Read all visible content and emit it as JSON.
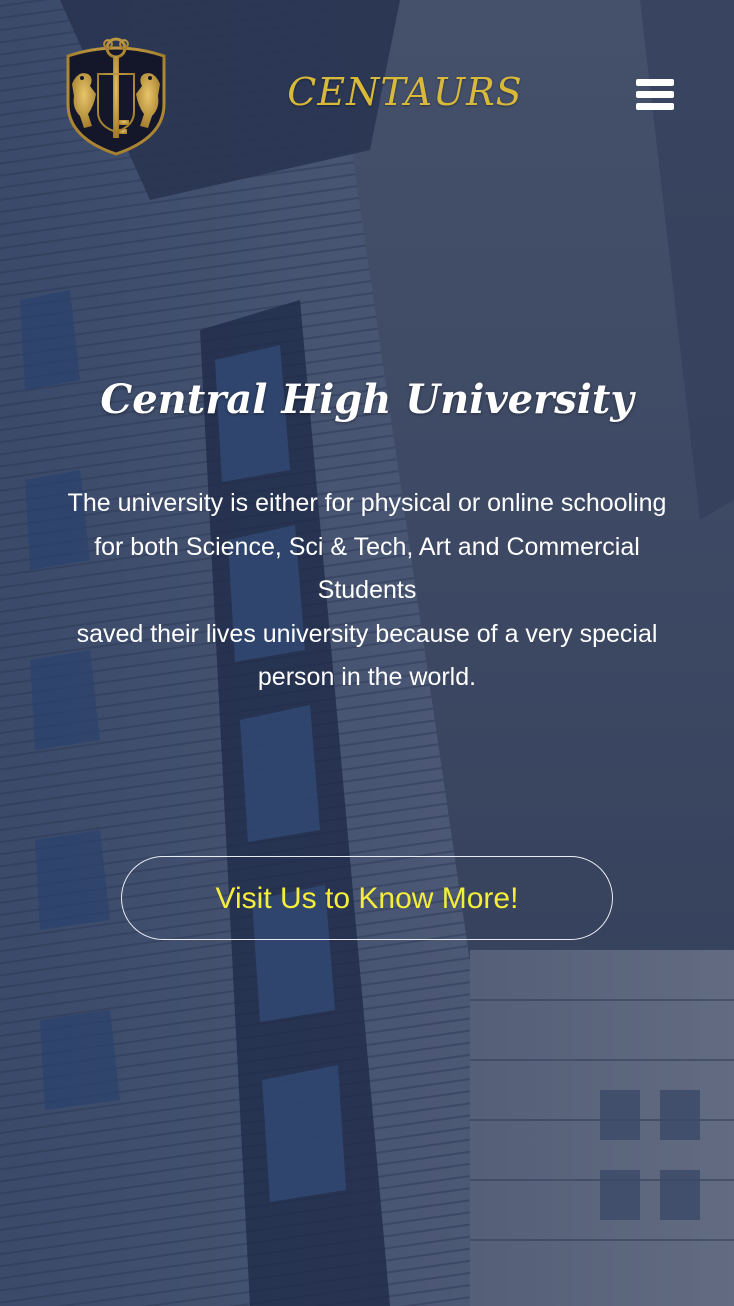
{
  "header": {
    "brand": "CENTAURS",
    "logo_icon": "university-crest-icon",
    "menu_icon": "hamburger-menu-icon"
  },
  "hero": {
    "title": "Central High University",
    "description_line_1": "The university is either for physical or online schooling for both Science, Sci & Tech, Art and Commercial Students",
    "description_line_2": "saved their lives university because of a very special person in the world.",
    "cta_label": "Visit Us to Know More!"
  },
  "colors": {
    "brand": "#d9b93a",
    "cta_text": "#f4ee3a",
    "overlay": "#1f2a44",
    "text": "#ffffff"
  }
}
